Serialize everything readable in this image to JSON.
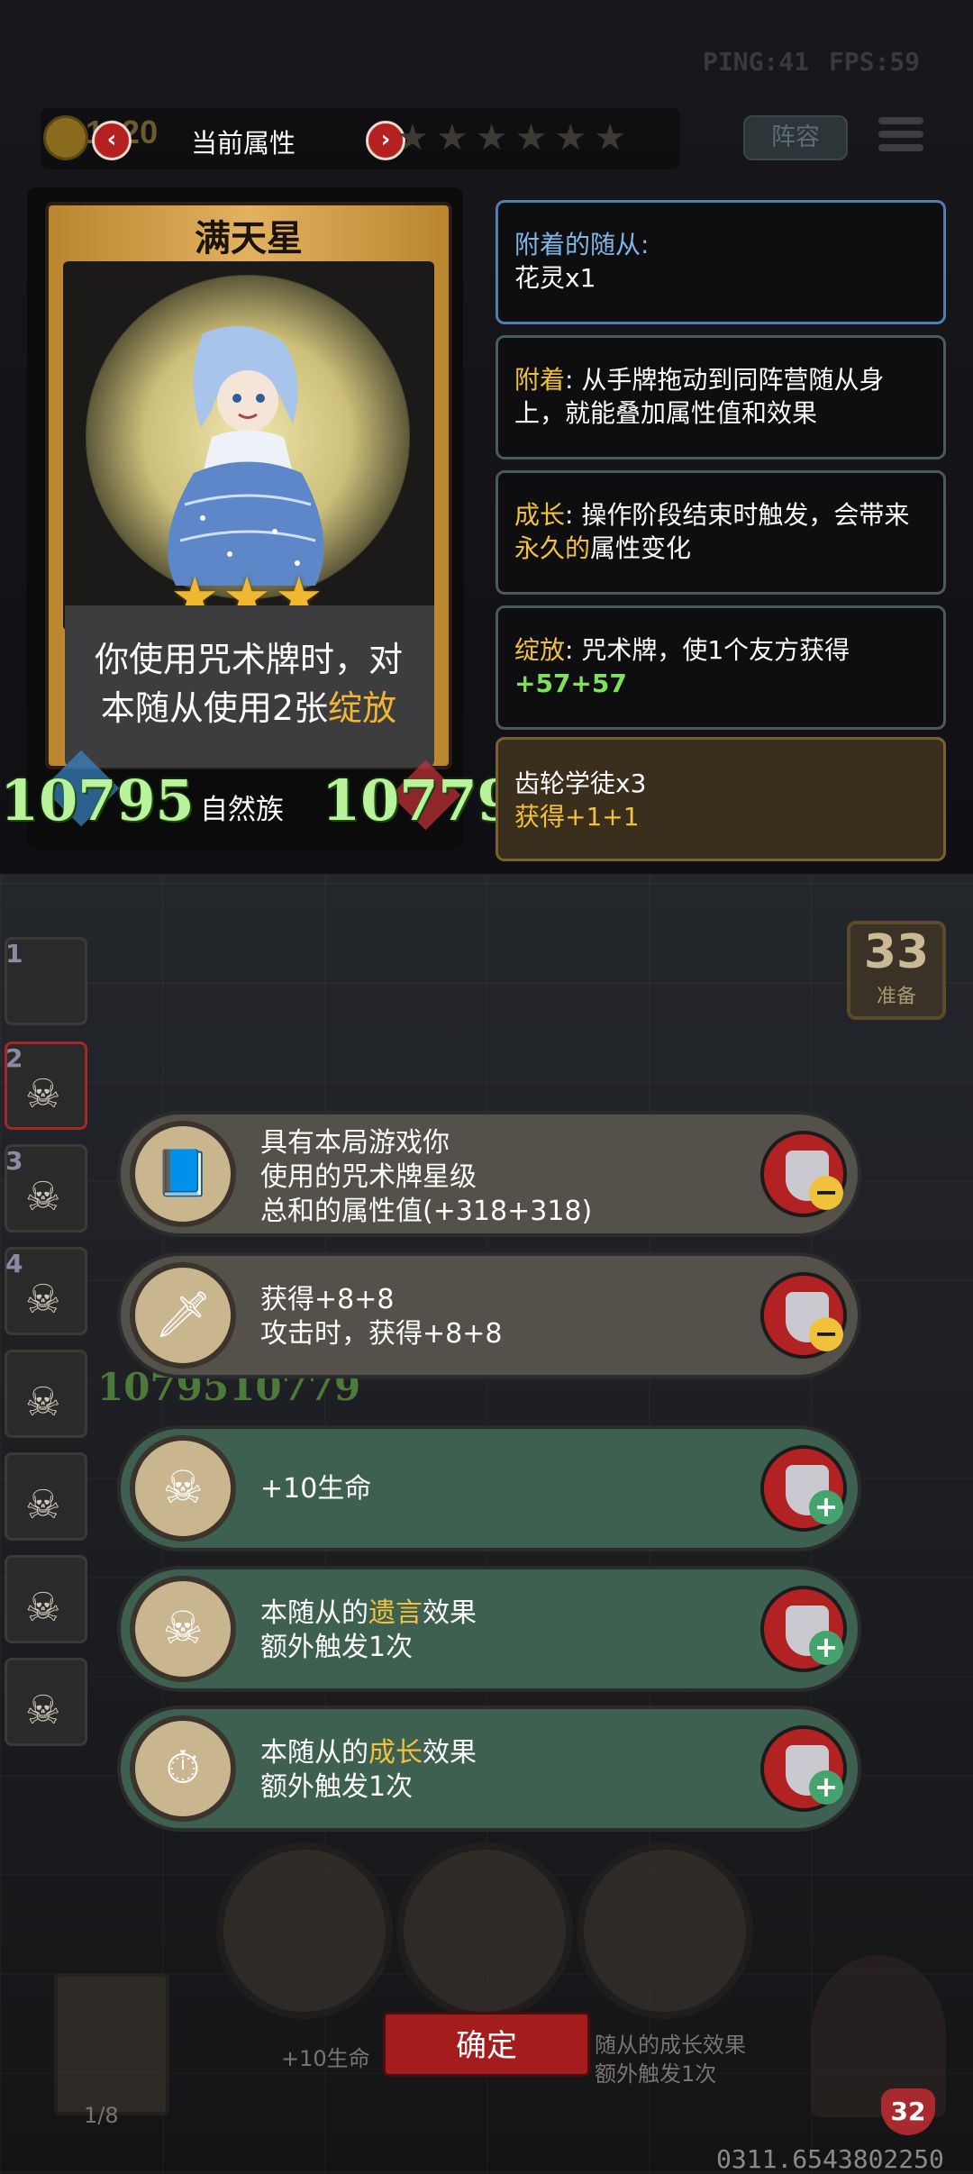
{
  "hud": {
    "ping": "PING:41",
    "fps": "FPS:59"
  },
  "header": {
    "gold_value": "1820",
    "title": "当前属性",
    "prev_icon": "chevron-left-icon",
    "next_icon": "chevron-right-icon",
    "stars": "★★★★★★",
    "lineup_label": "阵容"
  },
  "card": {
    "name": "满天星",
    "stars": "★★★",
    "desc_line1": "你使用咒术牌时，对",
    "desc_line2_prefix": "本随从使用2张",
    "desc_line2_highlight": "绽放",
    "attack": "10795",
    "health": "10779",
    "tribe": "自然族"
  },
  "panels": {
    "attached": {
      "title": "附着的随从:",
      "value": "花灵x1"
    },
    "attach": {
      "key": "附着",
      "text": ": 从手牌拖动到同阵营随从身上，就能叠加属性值和效果"
    },
    "growth": {
      "key": "成长",
      "text1": ": 操作阶段结束时触发，会带来",
      "key2": "永久的",
      "text2": "属性变化"
    },
    "bloom": {
      "key": "绽放",
      "text": ": 咒术牌，使1个友方获得",
      "bonus": "+57+57"
    },
    "gear": {
      "title": "齿轮学徒x3",
      "bonus": "获得+1+1"
    }
  },
  "side_list": {
    "nums": [
      "1",
      "2",
      "3",
      "4"
    ],
    "timer": "33",
    "timer_label": "准备"
  },
  "choices": [
    {
      "lines": [
        "具有本局游戏你",
        "使用的咒术牌星级",
        "总和的属性值(+318+318)"
      ],
      "icon": "spellbook-icon",
      "action": "minus"
    },
    {
      "lines": [
        "获得+8+8",
        "攻击时，获得+8+8"
      ],
      "icon": "sword-icon",
      "action": "minus"
    },
    {
      "lines": [
        "+10生命"
      ],
      "icon": "skull-token-icon",
      "action": "plus"
    },
    {
      "prefix": "本随从的",
      "highlight": "遗言",
      "suffix": "效果",
      "line2": "额外触发1次",
      "icon": "deathrattle-icon",
      "action": "plus"
    },
    {
      "prefix": "本随从的",
      "highlight": "成长",
      "suffix": "效果",
      "line2": "额外触发1次",
      "icon": "stopwatch-icon",
      "action": "plus"
    }
  ],
  "ghost_stats": "1079510779",
  "bottom": {
    "confirm_label": "确定",
    "ghost_left": "+10生命",
    "ghost_right1": "随从的成长效果",
    "ghost_right2": "额外触发1次",
    "page": "1/8",
    "hp": "32",
    "coords": "0311.6543802250"
  },
  "colors": {
    "accent_gold": "#f2c13c",
    "green_stat": "#b9f39c",
    "confirm_red": "#a51c1c"
  }
}
